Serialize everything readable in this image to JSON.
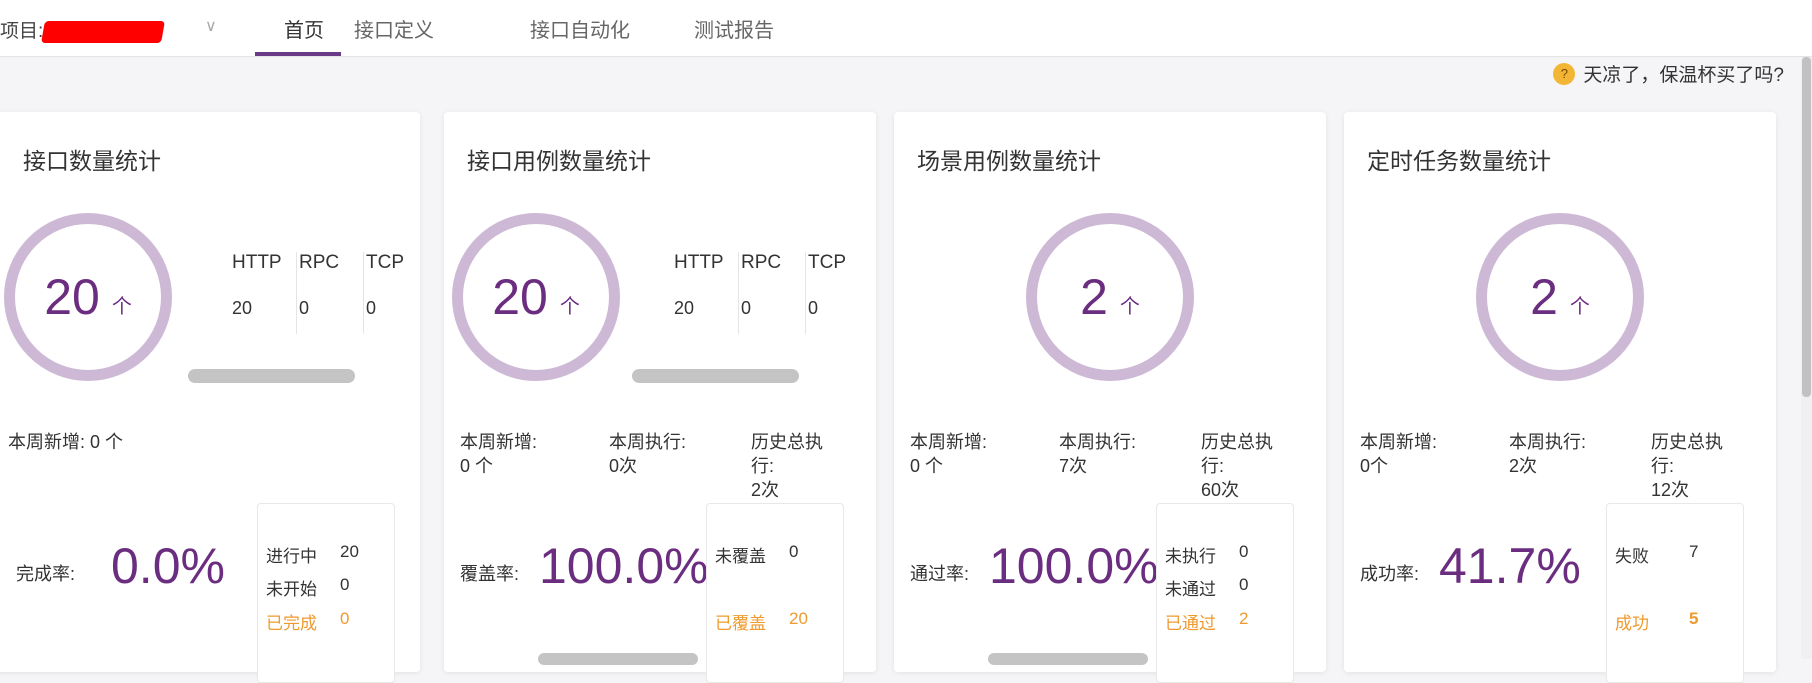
{
  "header": {
    "project_label": "项目:",
    "tabs": [
      {
        "label": "首页",
        "active": true
      },
      {
        "label": "接口定义"
      },
      {
        "label": "接口自动化"
      },
      {
        "label": "测试报告"
      }
    ]
  },
  "tip": {
    "icon": "thinking-face-emoji",
    "text": "天凉了，保温杯买了吗?"
  },
  "colors": {
    "accent": "#6b2d7f",
    "ring": "#cdb9d5",
    "highlight": "#ef9a2e"
  },
  "cards": [
    {
      "title": "接口数量统计",
      "count": "20",
      "unit": "个",
      "types": [
        {
          "h": "HTTP",
          "v": "20"
        },
        {
          "h": "RPC",
          "v": "0"
        },
        {
          "h": "TCP",
          "v": "0"
        }
      ],
      "stats": [
        "本周新增: 0 个"
      ],
      "rate_label": "完成率:",
      "rate": "0.0%",
      "legend": [
        {
          "k": "进行中",
          "v": "20"
        },
        {
          "k": "未开始",
          "v": "0"
        },
        {
          "k": "已完成",
          "v": "0"
        }
      ]
    },
    {
      "title": "接口用例数量统计",
      "count": "20",
      "unit": "个",
      "types": [
        {
          "h": "HTTP",
          "v": "20"
        },
        {
          "h": "RPC",
          "v": "0"
        },
        {
          "h": "TCP",
          "v": "0"
        }
      ],
      "stats": [
        "本周新增:\n0 个",
        "本周执行:\n0次",
        "历史总执\n行:\n2次"
      ],
      "rate_label": "覆盖率:",
      "rate": "100.0%",
      "legend": [
        {
          "k": "未覆盖",
          "v": "0"
        },
        {
          "k": "已覆盖",
          "v": "20"
        }
      ]
    },
    {
      "title": "场景用例数量统计",
      "count": "2",
      "unit": "个",
      "stats": [
        "本周新增:\n0 个",
        "本周执行:\n7次",
        "历史总执\n行:\n60次"
      ],
      "rate_label": "通过率:",
      "rate": "100.0%",
      "legend": [
        {
          "k": "未执行",
          "v": "0"
        },
        {
          "k": "未通过",
          "v": "0"
        },
        {
          "k": "已通过",
          "v": "2"
        }
      ]
    },
    {
      "title": "定时任务数量统计",
      "count": "2",
      "unit": "个",
      "stats": [
        "本周新增:\n0个",
        "本周执行:\n2次",
        "历史总执\n行:\n12次"
      ],
      "rate_label": "成功率:",
      "rate": "41.7%",
      "legend": [
        {
          "k": "失败",
          "v": "7"
        },
        {
          "k": "成功",
          "v": "5"
        }
      ]
    }
  ]
}
